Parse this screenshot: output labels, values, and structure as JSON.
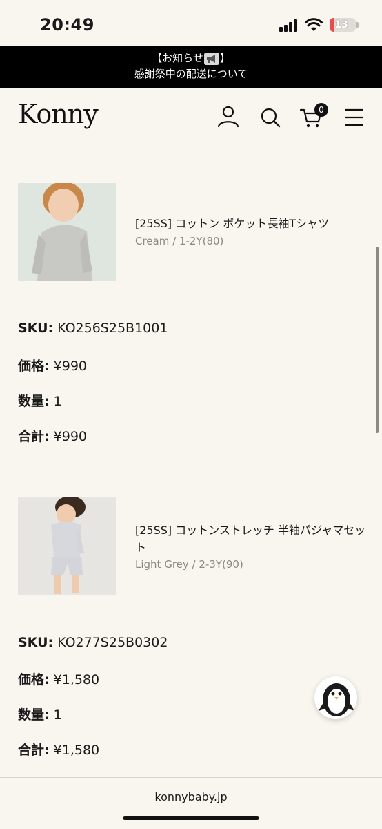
{
  "status_bar": {
    "time": "20:49",
    "battery": "13",
    "battery_level": 0.13
  },
  "announcement": {
    "line1_prefix": "【お知らせ",
    "line1_suffix": "】",
    "line2": "感謝祭中の配送について"
  },
  "header": {
    "logo": "Konny",
    "cart_count": "0"
  },
  "items": [
    {
      "title": "[25SS] コットン ポケット長袖Tシャツ",
      "variant": "Cream / 1-2Y(80)",
      "sku_label": "SKU:",
      "sku": "KO256S25B1001",
      "price_label": "価格:",
      "price": "¥990",
      "qty_label": "数量:",
      "qty": "1",
      "total_label": "合計:",
      "total": "¥990"
    },
    {
      "title": "[25SS] コットンストレッチ 半袖パジャマセット",
      "variant": "Light Grey / 2-3Y(90)",
      "sku_label": "SKU:",
      "sku": "KO277S25B0302",
      "price_label": "価格:",
      "price": "¥1,580",
      "qty_label": "数量:",
      "qty": "1",
      "total_label": "合計:",
      "total": "¥1,580"
    }
  ],
  "footer": {
    "domain": "konnybaby.jp"
  },
  "colors": {
    "background": "#f9f5ef",
    "announcement_bg": "#000000",
    "text": "#1a1a1a",
    "muted": "#8c8883",
    "battery_low": "#e84c4c"
  }
}
